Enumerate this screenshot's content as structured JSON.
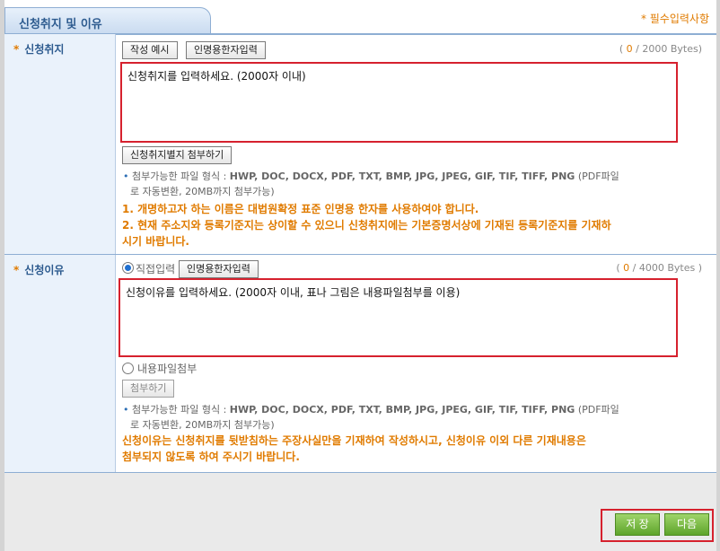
{
  "header": {
    "tab_title": "신청취지 및 이유",
    "required_note": "* 필수입력사항"
  },
  "section1": {
    "label": "신청취지",
    "required_mark": "*",
    "example_button": "작성 예시",
    "hanja_button": "인명용한자입력",
    "counter_open": "( ",
    "counter_value": "0",
    "counter_close": " / 2000 Bytes)",
    "textarea_placeholder": "신청취지를 입력하세요. (2000자 이내)",
    "attach_button": "신청취지별지 첨부하기",
    "file_info_prefix": "첨부가능한 파일 형식 :",
    "file_formats": "HWP, DOC, DOCX, PDF, TXT, BMP, JPG, JPEG, GIF, TIF, TIFF, PNG",
    "file_info_suffix_1": "(PDF파일",
    "file_info_suffix_2": "로 자동변환, 20MB까지 첨부가능)",
    "warning_1": "1. 개명하고자 하는 이름은 대법원확정 표준 인명용 한자를 사용하여야 합니다.",
    "warning_2a": "2. 현재 주소지와 등록기준지는 상이할 수 있으니 신청취지에는 기본증명서상에 기재된 등록기준지를 기재하",
    "warning_2b": "시기 바랍니다."
  },
  "section2": {
    "label": "신청이유",
    "required_mark": "*",
    "direct_input_label": "직접입력",
    "hanja_button": "인명용한자입력",
    "counter_open": "( ",
    "counter_value": "0",
    "counter_close": " / 4000 Bytes )",
    "textarea_placeholder": "신청이유를 입력하세요. (2000자 이내, 표나 그림은 내용파일첨부를 이용)",
    "file_attach_label": "내용파일첨부",
    "attach_button": "첨부하기",
    "file_info_prefix": "첨부가능한 파일 형식 :",
    "file_formats": "HWP, DOC, DOCX, PDF, TXT, BMP, JPG, JPEG, GIF, TIF, TIFF, PNG",
    "file_info_suffix_1": "(PDF파일",
    "file_info_suffix_2": "로 자동변환, 20MB까지 첨부가능)",
    "warning_a": "신청이유는 신청취지를 뒷받침하는 주장사실만을 기재하여 작성하시고, 신청이유 이외 다른 기재내용은",
    "warning_b": "첨부되지 않도록 하여 주시기 바랍니다."
  },
  "actions": {
    "save_label": "저 장",
    "next_label": "다음"
  },
  "colors": {
    "accent": "#2d5b8f",
    "warning": "#e07b00",
    "highlight": "#d6212e",
    "button_green": "#5ea52b"
  }
}
